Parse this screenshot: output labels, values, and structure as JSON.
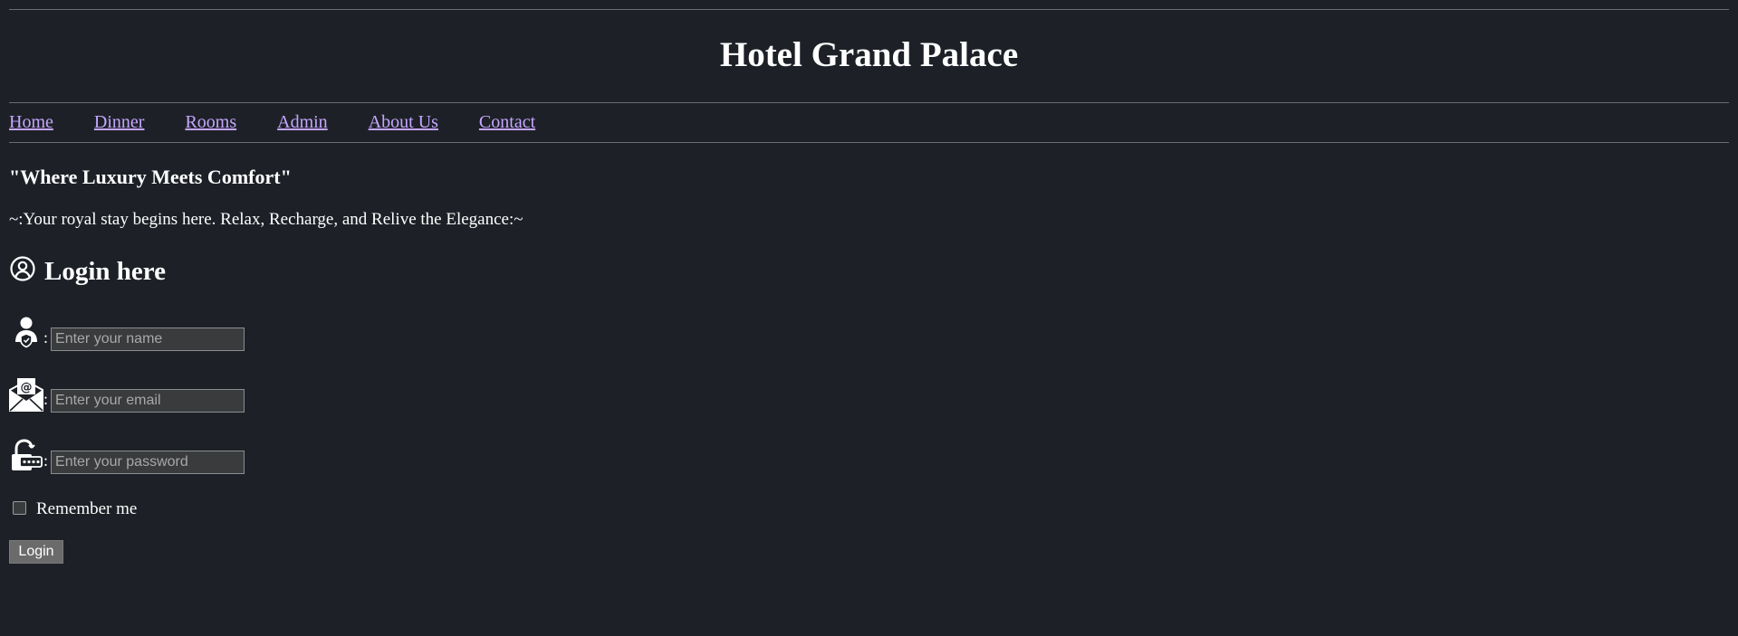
{
  "header": {
    "title": "Hotel Grand Palace"
  },
  "nav": {
    "items": [
      {
        "label": "Home"
      },
      {
        "label": "Dinner"
      },
      {
        "label": "Rooms"
      },
      {
        "label": "Admin"
      },
      {
        "label": "About Us"
      },
      {
        "label": "Contact"
      }
    ],
    "link_color": "#c5a6ff"
  },
  "intro": {
    "tagline": "\"Where Luxury Meets Comfort\"",
    "subline": "~:Your royal stay begins here. Relax, Recharge, and Relive the Elegance:~"
  },
  "login": {
    "heading": "Login here",
    "heading_icon": "user-circle-icon",
    "fields": [
      {
        "icon": "user-shield-icon",
        "separator": ":",
        "placeholder": "Enter your name",
        "value": ""
      },
      {
        "icon": "email-envelope-icon",
        "separator": ":",
        "placeholder": "Enter your email",
        "value": ""
      },
      {
        "icon": "password-lock-icon",
        "separator": ":",
        "placeholder": "Enter your password",
        "value": ""
      }
    ],
    "remember_label": "Remember me",
    "remember_checked": false,
    "submit_label": "Login"
  },
  "colors": {
    "background": "#1d2127",
    "text": "#ffffff",
    "button": "#6b6b6b"
  }
}
